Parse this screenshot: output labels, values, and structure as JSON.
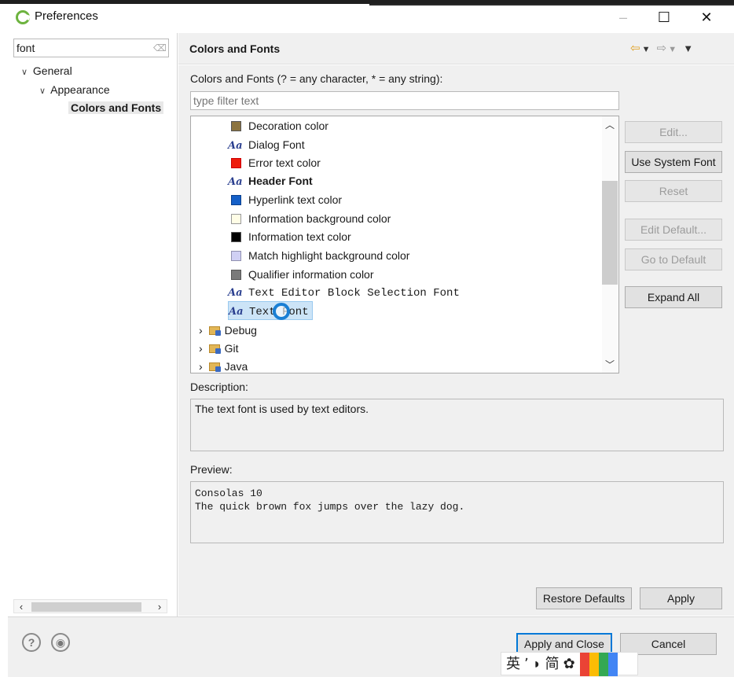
{
  "window": {
    "title": "Preferences",
    "buttons": {
      "minimize": "–",
      "maximize": "☐",
      "close": "✕"
    }
  },
  "left": {
    "search_value": "font",
    "tree": [
      {
        "label": "General"
      },
      {
        "label": "Appearance"
      },
      {
        "label": "Colors and Fonts"
      }
    ]
  },
  "header": {
    "title": "Colors and Fonts"
  },
  "main": {
    "filter_label": "Colors and Fonts (? = any character, * = any string):",
    "filter_placeholder": "type filter text",
    "items": [
      {
        "label": "Decoration color",
        "kind": "color",
        "color": "#8c7440"
      },
      {
        "label": "Dialog Font",
        "kind": "font"
      },
      {
        "label": "Error text color",
        "kind": "color",
        "color": "#ee1c0c"
      },
      {
        "label": "Header Font",
        "kind": "font"
      },
      {
        "label": "Hyperlink text color",
        "kind": "color",
        "color": "#1560c8"
      },
      {
        "label": "Information background color",
        "kind": "color",
        "color": "#fffde6"
      },
      {
        "label": "Information text color",
        "kind": "color",
        "color": "#000000"
      },
      {
        "label": "Match highlight background color",
        "kind": "color",
        "color": "#d0d0f4"
      },
      {
        "label": "Qualifier information color",
        "kind": "color",
        "color": "#7a7a7a"
      },
      {
        "label": "Text Editor Block Selection Font",
        "kind": "font"
      },
      {
        "label": "Text Font",
        "kind": "font"
      }
    ],
    "categories": [
      "Debug",
      "Git",
      "Java"
    ],
    "buttons": {
      "edit": "Edit...",
      "use_system_font": "Use System Font",
      "reset": "Reset",
      "edit_default": "Edit Default...",
      "go_to_default": "Go to Default",
      "expand_all": "Expand All"
    },
    "description_label": "Description:",
    "description_text": "The text font is used by text editors.",
    "preview_label": "Preview:",
    "preview_line1": "Consolas 10",
    "preview_line2": "The quick brown fox jumps over the lazy dog.",
    "restore_defaults": "Restore Defaults",
    "apply": "Apply"
  },
  "footer": {
    "apply_and_close": "Apply and Close",
    "cancel": "Cancel"
  },
  "ime": {
    "text": "英 ٬ ◗ 简 ✿"
  }
}
